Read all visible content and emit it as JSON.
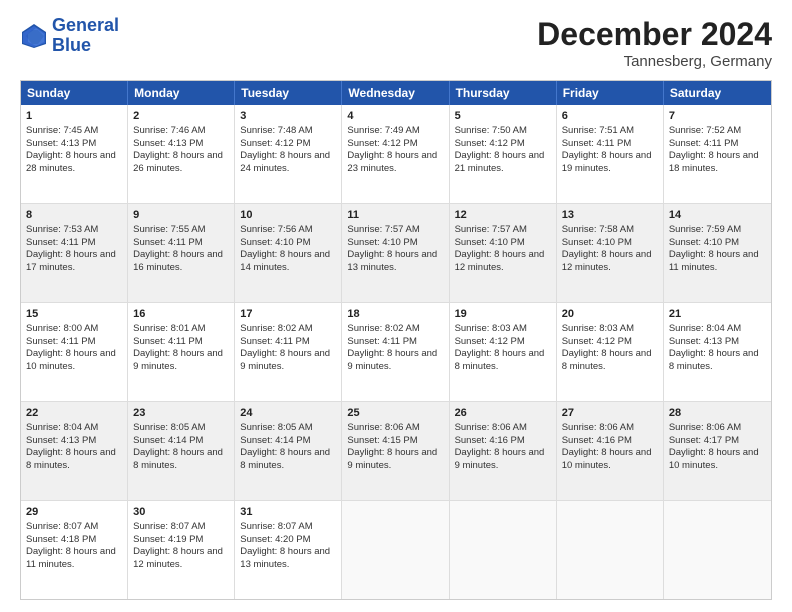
{
  "logo": {
    "line1": "General",
    "line2": "Blue"
  },
  "title": "December 2024",
  "subtitle": "Tannesberg, Germany",
  "days": [
    "Sunday",
    "Monday",
    "Tuesday",
    "Wednesday",
    "Thursday",
    "Friday",
    "Saturday"
  ],
  "rows": [
    [
      {
        "day": "1",
        "sunrise": "Sunrise: 7:45 AM",
        "sunset": "Sunset: 4:13 PM",
        "daylight": "Daylight: 8 hours and 28 minutes."
      },
      {
        "day": "2",
        "sunrise": "Sunrise: 7:46 AM",
        "sunset": "Sunset: 4:13 PM",
        "daylight": "Daylight: 8 hours and 26 minutes."
      },
      {
        "day": "3",
        "sunrise": "Sunrise: 7:48 AM",
        "sunset": "Sunset: 4:12 PM",
        "daylight": "Daylight: 8 hours and 24 minutes."
      },
      {
        "day": "4",
        "sunrise": "Sunrise: 7:49 AM",
        "sunset": "Sunset: 4:12 PM",
        "daylight": "Daylight: 8 hours and 23 minutes."
      },
      {
        "day": "5",
        "sunrise": "Sunrise: 7:50 AM",
        "sunset": "Sunset: 4:12 PM",
        "daylight": "Daylight: 8 hours and 21 minutes."
      },
      {
        "day": "6",
        "sunrise": "Sunrise: 7:51 AM",
        "sunset": "Sunset: 4:11 PM",
        "daylight": "Daylight: 8 hours and 19 minutes."
      },
      {
        "day": "7",
        "sunrise": "Sunrise: 7:52 AM",
        "sunset": "Sunset: 4:11 PM",
        "daylight": "Daylight: 8 hours and 18 minutes."
      }
    ],
    [
      {
        "day": "8",
        "sunrise": "Sunrise: 7:53 AM",
        "sunset": "Sunset: 4:11 PM",
        "daylight": "Daylight: 8 hours and 17 minutes."
      },
      {
        "day": "9",
        "sunrise": "Sunrise: 7:55 AM",
        "sunset": "Sunset: 4:11 PM",
        "daylight": "Daylight: 8 hours and 16 minutes."
      },
      {
        "day": "10",
        "sunrise": "Sunrise: 7:56 AM",
        "sunset": "Sunset: 4:10 PM",
        "daylight": "Daylight: 8 hours and 14 minutes."
      },
      {
        "day": "11",
        "sunrise": "Sunrise: 7:57 AM",
        "sunset": "Sunset: 4:10 PM",
        "daylight": "Daylight: 8 hours and 13 minutes."
      },
      {
        "day": "12",
        "sunrise": "Sunrise: 7:57 AM",
        "sunset": "Sunset: 4:10 PM",
        "daylight": "Daylight: 8 hours and 12 minutes."
      },
      {
        "day": "13",
        "sunrise": "Sunrise: 7:58 AM",
        "sunset": "Sunset: 4:10 PM",
        "daylight": "Daylight: 8 hours and 12 minutes."
      },
      {
        "day": "14",
        "sunrise": "Sunrise: 7:59 AM",
        "sunset": "Sunset: 4:10 PM",
        "daylight": "Daylight: 8 hours and 11 minutes."
      }
    ],
    [
      {
        "day": "15",
        "sunrise": "Sunrise: 8:00 AM",
        "sunset": "Sunset: 4:11 PM",
        "daylight": "Daylight: 8 hours and 10 minutes."
      },
      {
        "day": "16",
        "sunrise": "Sunrise: 8:01 AM",
        "sunset": "Sunset: 4:11 PM",
        "daylight": "Daylight: 8 hours and 9 minutes."
      },
      {
        "day": "17",
        "sunrise": "Sunrise: 8:02 AM",
        "sunset": "Sunset: 4:11 PM",
        "daylight": "Daylight: 8 hours and 9 minutes."
      },
      {
        "day": "18",
        "sunrise": "Sunrise: 8:02 AM",
        "sunset": "Sunset: 4:11 PM",
        "daylight": "Daylight: 8 hours and 9 minutes."
      },
      {
        "day": "19",
        "sunrise": "Sunrise: 8:03 AM",
        "sunset": "Sunset: 4:12 PM",
        "daylight": "Daylight: 8 hours and 8 minutes."
      },
      {
        "day": "20",
        "sunrise": "Sunrise: 8:03 AM",
        "sunset": "Sunset: 4:12 PM",
        "daylight": "Daylight: 8 hours and 8 minutes."
      },
      {
        "day": "21",
        "sunrise": "Sunrise: 8:04 AM",
        "sunset": "Sunset: 4:13 PM",
        "daylight": "Daylight: 8 hours and 8 minutes."
      }
    ],
    [
      {
        "day": "22",
        "sunrise": "Sunrise: 8:04 AM",
        "sunset": "Sunset: 4:13 PM",
        "daylight": "Daylight: 8 hours and 8 minutes."
      },
      {
        "day": "23",
        "sunrise": "Sunrise: 8:05 AM",
        "sunset": "Sunset: 4:14 PM",
        "daylight": "Daylight: 8 hours and 8 minutes."
      },
      {
        "day": "24",
        "sunrise": "Sunrise: 8:05 AM",
        "sunset": "Sunset: 4:14 PM",
        "daylight": "Daylight: 8 hours and 8 minutes."
      },
      {
        "day": "25",
        "sunrise": "Sunrise: 8:06 AM",
        "sunset": "Sunset: 4:15 PM",
        "daylight": "Daylight: 8 hours and 9 minutes."
      },
      {
        "day": "26",
        "sunrise": "Sunrise: 8:06 AM",
        "sunset": "Sunset: 4:16 PM",
        "daylight": "Daylight: 8 hours and 9 minutes."
      },
      {
        "day": "27",
        "sunrise": "Sunrise: 8:06 AM",
        "sunset": "Sunset: 4:16 PM",
        "daylight": "Daylight: 8 hours and 10 minutes."
      },
      {
        "day": "28",
        "sunrise": "Sunrise: 8:06 AM",
        "sunset": "Sunset: 4:17 PM",
        "daylight": "Daylight: 8 hours and 10 minutes."
      }
    ],
    [
      {
        "day": "29",
        "sunrise": "Sunrise: 8:07 AM",
        "sunset": "Sunset: 4:18 PM",
        "daylight": "Daylight: 8 hours and 11 minutes."
      },
      {
        "day": "30",
        "sunrise": "Sunrise: 8:07 AM",
        "sunset": "Sunset: 4:19 PM",
        "daylight": "Daylight: 8 hours and 12 minutes."
      },
      {
        "day": "31",
        "sunrise": "Sunrise: 8:07 AM",
        "sunset": "Sunset: 4:20 PM",
        "daylight": "Daylight: 8 hours and 13 minutes."
      },
      null,
      null,
      null,
      null
    ]
  ]
}
